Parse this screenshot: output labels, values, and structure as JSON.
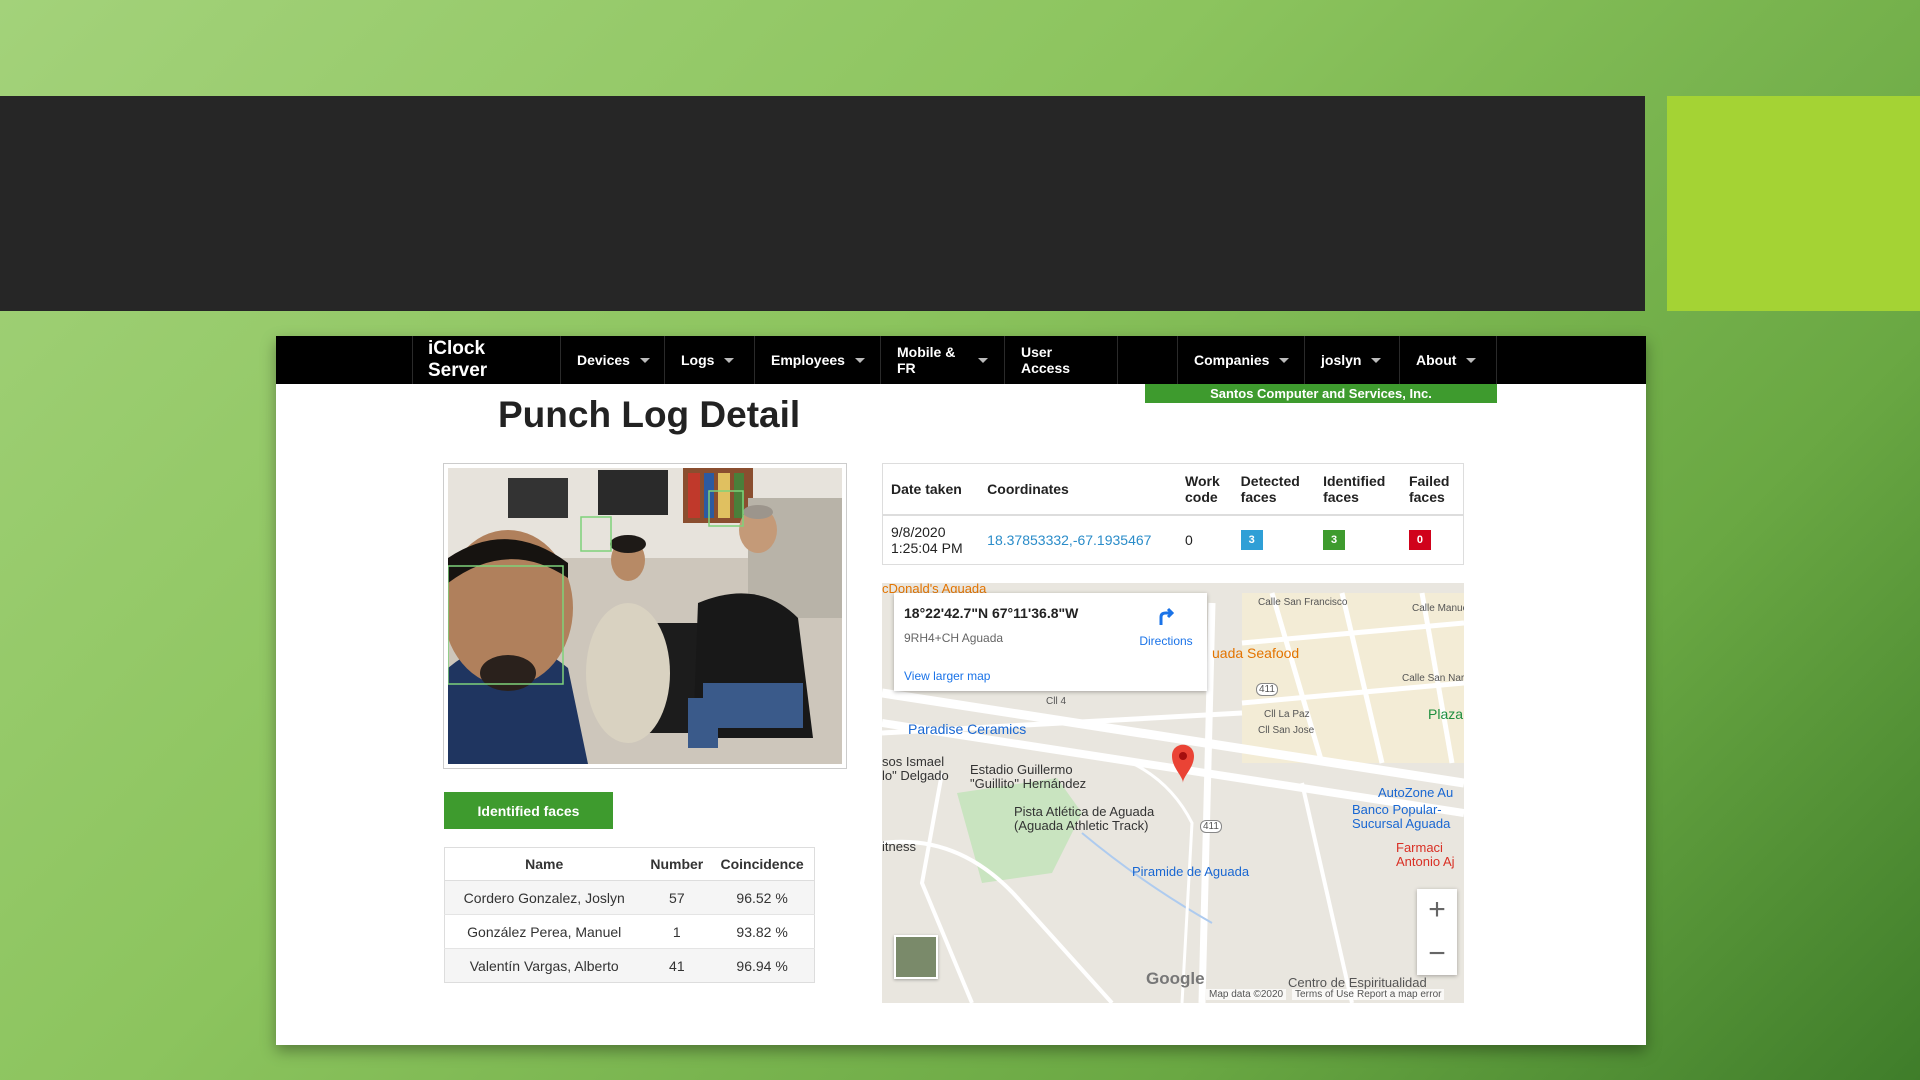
{
  "navbar": {
    "brand": "iClock Server",
    "items": [
      {
        "label": "Devices"
      },
      {
        "label": "Logs"
      },
      {
        "label": "Employees"
      },
      {
        "label": "Mobile & FR"
      },
      {
        "label": "User Access"
      },
      {
        "label": "Companies"
      },
      {
        "label": "joslyn"
      },
      {
        "label": "About"
      }
    ],
    "company": "Santos Computer and Services, Inc."
  },
  "page_title": "Punch Log Detail",
  "identified_button": "Identified faces",
  "faces_table": {
    "headers": [
      "Name",
      "Number",
      "Coincidence"
    ],
    "rows": [
      {
        "name": "Cordero Gonzalez, Joslyn",
        "number": "57",
        "coincidence": "96.52 %"
      },
      {
        "name": "González Perea, Manuel",
        "number": "1",
        "coincidence": "93.82 %"
      },
      {
        "name": "Valentín Vargas, Alberto",
        "number": "41",
        "coincidence": "96.94 %"
      }
    ]
  },
  "info_table": {
    "headers": {
      "date_taken": "Date taken",
      "coordinates": "Coordinates",
      "work_code_1": "Work",
      "work_code_2": "code",
      "detected_1": "Detected",
      "detected_2": "faces",
      "identified_1": "Identified",
      "identified_2": "faces",
      "failed_1": "Failed",
      "failed_2": "faces"
    },
    "row": {
      "date": "9/8/2020",
      "time": "1:25:04 PM",
      "coordinates": "18.37853332,-67.1935467",
      "work_code": "0",
      "detected": "3",
      "identified": "3",
      "failed": "0"
    },
    "badge_colors": {
      "detected": "#2f9fd6",
      "identified": "#3e9b2e",
      "failed": "#d0021b"
    }
  },
  "map": {
    "coords": "18°22'42.7\"N 67°11'36.8\"W",
    "plus_code": "9RH4+CH Aguada",
    "directions": "Directions",
    "view_larger": "View larger map",
    "zoom_in": "+",
    "zoom_out": "−",
    "google": "Google",
    "footer": {
      "data": "Map data ©2020",
      "terms": "Terms of Use",
      "report": "Report a map error"
    },
    "places": {
      "mcdonalds": "cDonald's Aguada",
      "seafood": "uada Seafood",
      "plaza": "Plaza F",
      "paradise": "Paradise Ceramics",
      "ismael_1": "sos Ismael",
      "ismael_2": "lo\" Delgado",
      "estadio_1": "Estadio Guillermo",
      "estadio_2": "\"Guillito\" Hernández",
      "pista_1": "Pista Atlética de Aguada",
      "pista_2": "(Aguada Athletic Track)",
      "fitness": "itness",
      "piramide": "Piramide de Aguada",
      "autozone": "AutoZone Au",
      "banco_1": "Banco Popular-",
      "banco_2": "Sucursal Aguada",
      "farmacia_1": "Farmaci",
      "farmacia_2": "Antonio Aj",
      "centro": "Centro de Espiritualidad",
      "calle_francisco": "Calle San Francisco",
      "calle_manuel": "Calle Manuel Ruiz",
      "calle_narciso": "Calle San Nar",
      "calle_4": "Cll 4",
      "calle_paz": "Cll La Paz",
      "calle_jose": "Cll San Jose",
      "route": "411",
      "route2": "411"
    }
  }
}
